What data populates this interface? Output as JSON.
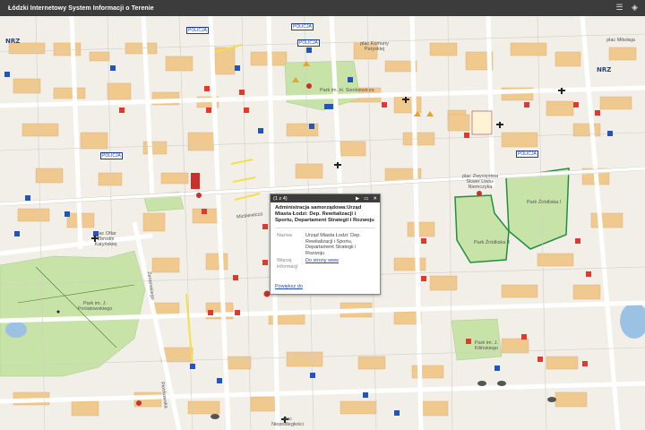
{
  "app": {
    "title": "Łódzki Internetowy System Informacji o Terenie"
  },
  "toolbar": {
    "icons": [
      "list-icon",
      "layers-icon"
    ]
  },
  "map": {
    "labels": [
      {
        "text": "Park im. H. Sienkiewicza"
      },
      {
        "text": "plac Zwycięstwa Skwer Liwiu-Niemczyka"
      },
      {
        "text": "Park Źródliska II"
      },
      {
        "text": "Park Źródliska I"
      },
      {
        "text": "plac Komuny Paryskiej"
      },
      {
        "text": "plac Ofiar Zbrodni Katyńskiej"
      },
      {
        "text": "Park im. J. Poniatowskiego"
      },
      {
        "text": "Park im. J. Kilińskiego"
      },
      {
        "text": "plac Niepodległości"
      },
      {
        "text": "plac Mikołaja"
      },
      {
        "text": "Mickiewicza"
      },
      {
        "text": "Żeromskiego"
      },
      {
        "text": "Piotrkowska"
      }
    ],
    "police_labels": [
      "POLICJA",
      "POLICJA",
      "POLICJA",
      "POLICJA",
      "POLICJA"
    ],
    "poi_icons": [
      "church-icon",
      "hospital-icon",
      "fire-icon",
      "theatre-icon",
      "pharmacy-icon",
      "bus-stop-icon"
    ]
  },
  "popup": {
    "counter": "(1 z 4)",
    "title": "Administracja samorządowa:Urząd Miasta Łodzi: Dep. Rewitalizacji i Sportu, Departament Strategii i Rozwoju",
    "fields": [
      {
        "key": "Nazwa",
        "value": "Urząd Miasta Łodzi: Dep. Rewitalizacji i Sportu, Departament Strategii i Rozwoju"
      },
      {
        "key": "Więcej informacji",
        "value": "Do strony www"
      }
    ],
    "zoom_link": "Powiększ do"
  }
}
